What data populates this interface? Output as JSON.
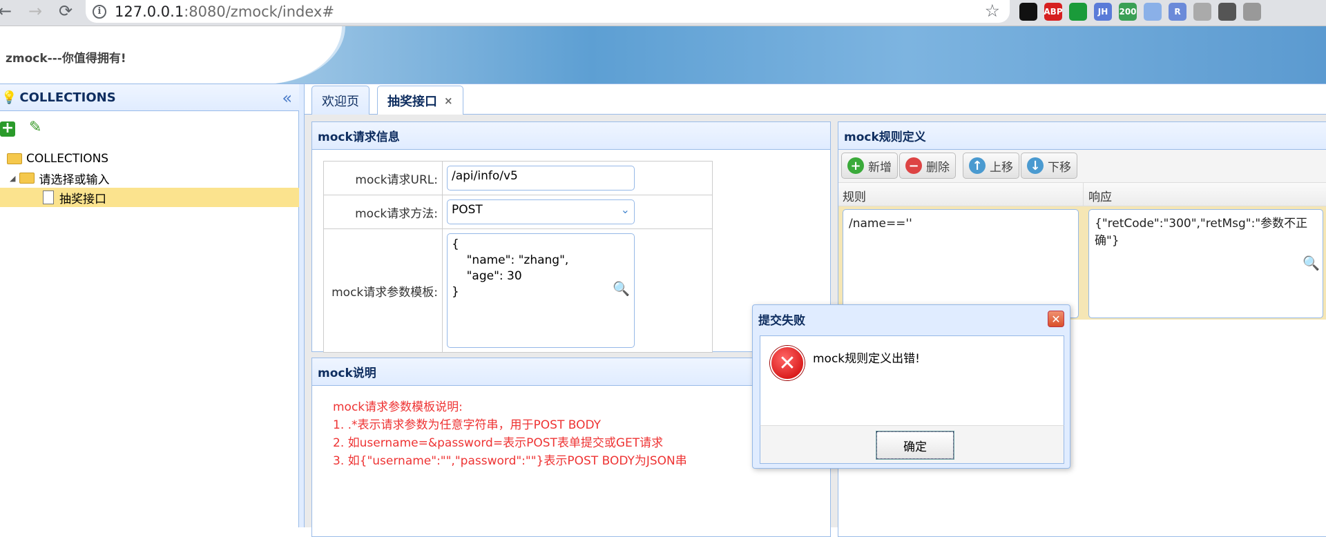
{
  "browser": {
    "url_host": "127.0.0.1",
    "url_rest": ":8080/zmock/index#",
    "extensions": [
      {
        "label": "",
        "color": "#111111"
      },
      {
        "label": "ABP",
        "color": "#d62020"
      },
      {
        "label": "",
        "color": "#1a9b3a"
      },
      {
        "label": "JH",
        "color": "#5a7bd8"
      },
      {
        "label": "200",
        "color": "#3aa055"
      },
      {
        "label": "",
        "color": "#8ab0e8"
      },
      {
        "label": "R",
        "color": "#6b8ad9"
      },
      {
        "label": "",
        "color": "#aaaaaa"
      },
      {
        "label": "",
        "color": "#555555"
      },
      {
        "label": "",
        "color": "#999999"
      }
    ]
  },
  "header": {
    "app_title": "zmock---你值得拥有!"
  },
  "left_panel": {
    "title": "COLLECTIONS",
    "tree": {
      "root": "COLLECTIONS",
      "child": "请选择或输入",
      "leaf": "抽奖接口"
    }
  },
  "tabs": {
    "welcome": "欢迎页",
    "active": "抽奖接口",
    "close": "×"
  },
  "request_panel": {
    "title": "mock请求信息",
    "url_label": "mock请求URL:",
    "url_value": "/api/info/v5",
    "method_label": "mock请求方法:",
    "method_value": "POST",
    "params_label": "mock请求参数模板:",
    "params_value": "{\n    \"name\": \"zhang\",\n    \"age\": 30\n}"
  },
  "desc_panel": {
    "title": "mock说明",
    "lines": [
      "mock请求参数模板说明:",
      "1. .*表示请求参数为任意字符串，用于POST BODY",
      "2. 如username=&password=表示POST表单提交或GET请求",
      "3. 如{\"username\":\"\",\"password\":\"\"}表示POST BODY为JSON串"
    ]
  },
  "rules_panel": {
    "title": "mock规则定义",
    "btn_add": "新增",
    "btn_delete": "删除",
    "btn_up": "上移",
    "btn_down": "下移",
    "col_rule": "规则",
    "col_response": "响应",
    "rule_value": "/name==''",
    "response_value": "{\"retCode\":\"300\",\"retMsg\":\"参数不正确\"}"
  },
  "dialog": {
    "title": "提交失败",
    "message": "mock规则定义出错!",
    "ok": "确定"
  }
}
